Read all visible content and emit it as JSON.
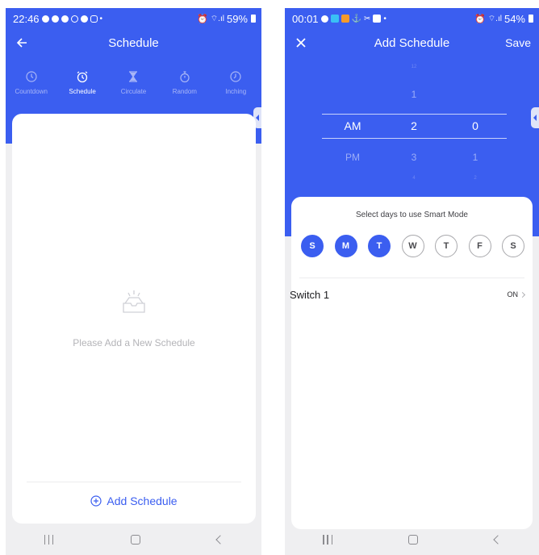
{
  "colors": {
    "brand": "#3b5ef0",
    "background": "#efeff1",
    "muted": "#b4b4b8"
  },
  "screen1": {
    "status": {
      "time": "22:46",
      "battery": "59%"
    },
    "title": "Schedule",
    "modes": [
      {
        "label": "Countdown",
        "icon": "clock-icon",
        "active": false
      },
      {
        "label": "Schedule",
        "icon": "alarm-icon",
        "active": true
      },
      {
        "label": "Circulate",
        "icon": "hourglass-icon",
        "active": false
      },
      {
        "label": "Random",
        "icon": "stopwatch-icon",
        "active": false
      },
      {
        "label": "Inching",
        "icon": "timer-icon",
        "active": false
      }
    ],
    "empty_text": "Please Add a New Schedule",
    "add_label": "Add Schedule"
  },
  "screen2": {
    "status": {
      "time": "00:01",
      "battery": "54%"
    },
    "title": "Add Schedule",
    "save_label": "Save",
    "picker": {
      "ampm": {
        "selected": "AM",
        "next": "PM"
      },
      "hour": {
        "faint_prev": "12",
        "prev": "1",
        "selected": "2",
        "next": "3",
        "faint_next": "4"
      },
      "minute": {
        "selected": "0",
        "next": "1",
        "faint_next": "2"
      }
    },
    "days_title": "Select days to use Smart Mode",
    "days": [
      {
        "label": "S",
        "on": true
      },
      {
        "label": "M",
        "on": true
      },
      {
        "label": "T",
        "on": true
      },
      {
        "label": "W",
        "on": false
      },
      {
        "label": "T",
        "on": false
      },
      {
        "label": "F",
        "on": false
      },
      {
        "label": "S",
        "on": false
      }
    ],
    "switch": {
      "label": "Switch 1",
      "state": "ON"
    }
  }
}
